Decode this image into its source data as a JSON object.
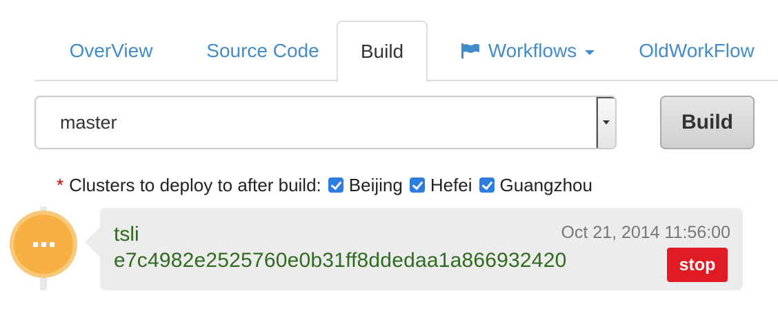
{
  "tabs": [
    {
      "label": "OverView",
      "active": false
    },
    {
      "label": "Source Code",
      "active": false
    },
    {
      "label": "Build",
      "active": true
    },
    {
      "label": "Workflows",
      "active": false,
      "icon": "flag-icon",
      "dropdown": true
    },
    {
      "label": "OldWorkFlow",
      "active": false
    }
  ],
  "branch_select": {
    "value": "master"
  },
  "build_button": {
    "label": "Build"
  },
  "clusters": {
    "required_marker": "*",
    "label": "Clusters to deploy to after build:",
    "options": [
      {
        "label": "Beijing",
        "checked": true
      },
      {
        "label": "Hefei",
        "checked": true
      },
      {
        "label": "Guangzhou",
        "checked": true
      }
    ]
  },
  "build_entry": {
    "status_icon": "more-dots-icon",
    "author": "tsli",
    "commit": "e7c4982e2525760e0b31ff8ddedaa1a866932420",
    "timestamp": "Oct 21, 2014 11:56:00",
    "stop_label": "stop"
  },
  "colors": {
    "link": "#428bca",
    "status_pending": "#f6b044",
    "stop": "#e01b24",
    "commit_text": "#2e6b1f",
    "checkbox": "#2d7de0"
  }
}
